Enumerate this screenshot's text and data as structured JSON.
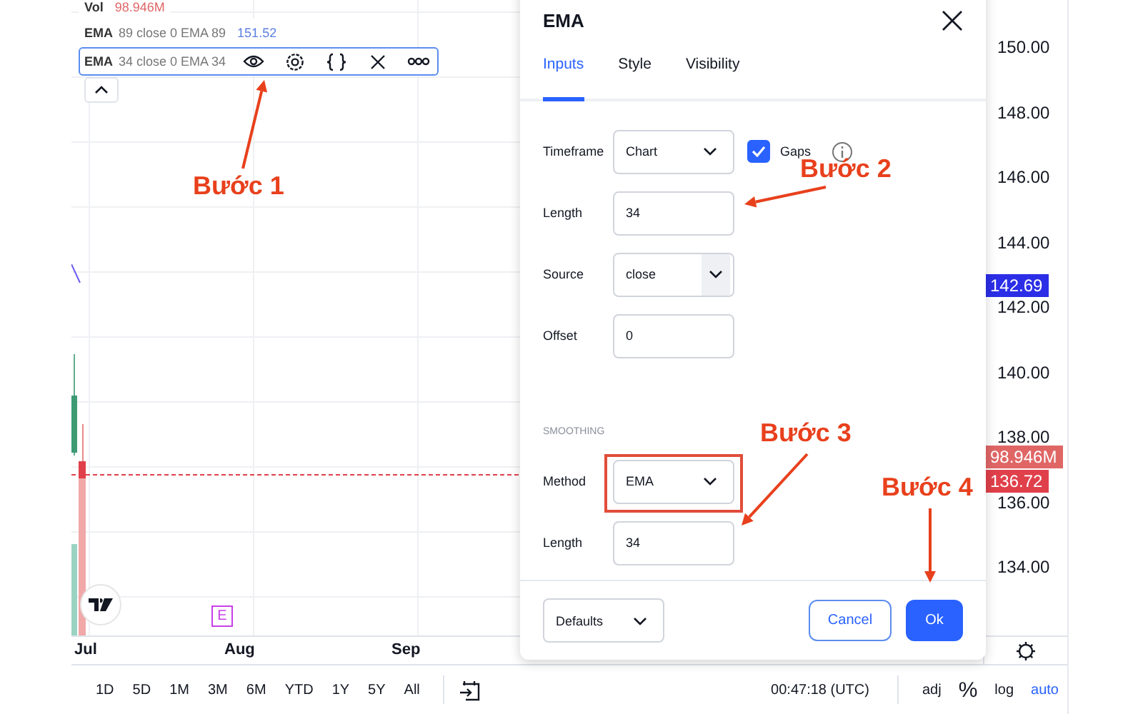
{
  "legend": {
    "volume": {
      "label": "Vol",
      "value": "98.946M"
    },
    "ema_rows": [
      {
        "name": "EMA",
        "params": "89 close 0 EMA 89",
        "value": "151.52",
        "selected": false
      },
      {
        "name": "EMA",
        "params": "34 close 0 EMA 34",
        "selected": true
      }
    ]
  },
  "chart": {
    "time_labels": [
      "Jul",
      "Aug",
      "Sep"
    ],
    "event_marker": "E"
  },
  "price_axis": {
    "labels": [
      "150.00",
      "148.00",
      "146.00",
      "144.00",
      "142.00",
      "140.00",
      "138.00",
      "136.00",
      "134.00"
    ],
    "badges": [
      {
        "text": "142.69",
        "color": "#2b2ee6"
      },
      {
        "text": "98.946M",
        "color": "#e06666"
      },
      {
        "text": "136.72",
        "color": "#e0404a"
      }
    ]
  },
  "range_buttons": [
    "1D",
    "5D",
    "1M",
    "3M",
    "6M",
    "YTD",
    "1Y",
    "5Y",
    "All"
  ],
  "status": {
    "time": "00:47:18 (UTC)",
    "adj": "adj",
    "percent": "%",
    "log": "log",
    "auto": {
      "label": "auto",
      "selected": true
    }
  },
  "dialog": {
    "title": "EMA",
    "tabs": [
      {
        "label": "Inputs",
        "selected": true
      },
      {
        "label": "Style",
        "selected": false
      },
      {
        "label": "Visibility",
        "selected": false
      }
    ],
    "timeframe": {
      "label": "Timeframe",
      "value": "Chart",
      "gaps_label": "Gaps",
      "gaps_checked": true
    },
    "length": {
      "label": "Length",
      "value": "34"
    },
    "source": {
      "label": "Source",
      "value": "close"
    },
    "offset": {
      "label": "Offset",
      "value": "0"
    },
    "section": "SMOOTHING",
    "method": {
      "label": "Method",
      "value": "EMA"
    },
    "smoothing_length": {
      "label": "Length",
      "value": "34"
    },
    "footer": {
      "defaults": "Defaults",
      "cancel": "Cancel",
      "ok": "Ok"
    }
  },
  "annotations": [
    "Bước 1",
    "Bước 2",
    "Bước 3",
    "Bước 4"
  ]
}
